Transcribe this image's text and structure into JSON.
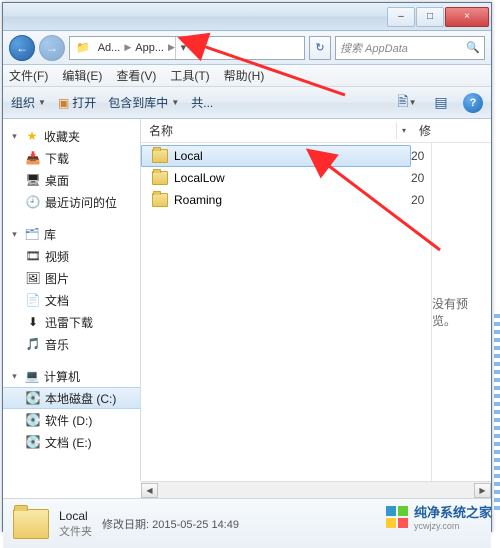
{
  "window": {
    "min_tip": "–",
    "max_tip": "□",
    "close_tip": "×"
  },
  "nav": {
    "back": "←",
    "forward": "→",
    "refresh": "↻"
  },
  "breadcrumb": {
    "seg1": "Ad...",
    "seg2": "App..."
  },
  "search": {
    "placeholder": "搜索 AppData"
  },
  "menubar": {
    "file": "文件(F)",
    "edit": "编辑(E)",
    "view": "查看(V)",
    "tools": "工具(T)",
    "help": "帮助(H)"
  },
  "toolbar": {
    "organize": "组织",
    "open": "打开",
    "include": "包含到库中",
    "share": "共..."
  },
  "columns": {
    "name": "名称",
    "modified": "修"
  },
  "sidebar": {
    "favorites": "收藏夹",
    "downloads": "下载",
    "desktop": "桌面",
    "recent": "最近访问的位",
    "libraries": "库",
    "videos": "视频",
    "pictures": "图片",
    "documents": "文档",
    "thunder": "迅雷下载",
    "music": "音乐",
    "computer": "计算机",
    "disk_c": "本地磁盘 (C:)",
    "disk_d": "软件 (D:)",
    "disk_e": "文档 (E:)"
  },
  "files": [
    {
      "name": "Local",
      "date_prefix": "20"
    },
    {
      "name": "LocalLow",
      "date_prefix": "20"
    },
    {
      "name": "Roaming",
      "date_prefix": "20"
    }
  ],
  "preview": {
    "empty": "没有预览。"
  },
  "details": {
    "selected_name": "Local",
    "type": "文件夹",
    "mod_label": "修改日期:",
    "mod_value": "2015-05-25 14:49"
  },
  "watermark": {
    "title": "纯净系统之家",
    "sub": "ycwjzy.com"
  }
}
